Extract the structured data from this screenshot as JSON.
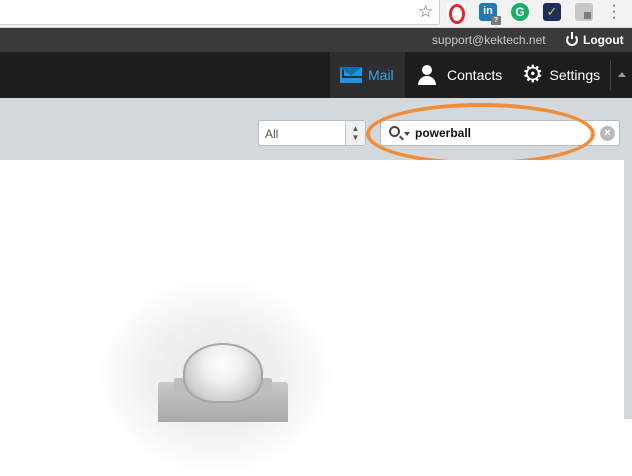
{
  "browser": {
    "extensions": [
      "opera-icon",
      "linkedin-icon",
      "grammarly-icon",
      "checklist-icon",
      "grey-extension-icon"
    ],
    "linkedin_label": "in",
    "linkedin_badge": "?",
    "grammarly_label": "G",
    "check_label": "✓"
  },
  "account": {
    "email": "support@kektech.net",
    "logout_label": "Logout"
  },
  "nav": {
    "mail_label": "Mail",
    "contacts_label": "Contacts",
    "settings_label": "Settings",
    "active": "Mail",
    "active_color": "#3aa3e6"
  },
  "toolbar": {
    "folder_value": "All",
    "search_value": "powerball"
  },
  "annotation": {
    "color": "#f28c38"
  }
}
